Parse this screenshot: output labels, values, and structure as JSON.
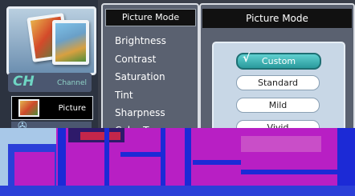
{
  "left_menu": {
    "channel": {
      "letters": "CH",
      "label": "Channel"
    },
    "picture": {
      "label": "Picture"
    }
  },
  "middle": {
    "header": "Picture Mode",
    "items": [
      "Brightness",
      "Contrast",
      "Saturation",
      "Tint",
      "Sharpness",
      "Color Temp"
    ]
  },
  "right": {
    "header": "Picture Mode",
    "check": "√",
    "options": [
      {
        "label": "Custom",
        "selected": true
      },
      {
        "label": "Standard",
        "selected": false
      },
      {
        "label": "Mild",
        "selected": false
      },
      {
        "label": "Vivid",
        "selected": false
      }
    ]
  },
  "colors": {
    "glitch_magenta": "#b81fc4",
    "glitch_blue": "#1c2ad6",
    "selected_option": "#2a9a9c"
  }
}
